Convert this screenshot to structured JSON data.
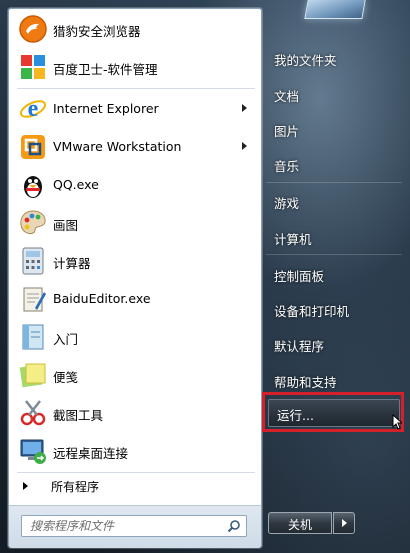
{
  "pinned_programs": [
    {
      "label": "猎豹安全浏览器",
      "icon": "cheetah-browser-icon"
    },
    {
      "label": "百度卫士-软件管理",
      "icon": "baidu-guard-software-icon"
    }
  ],
  "recent_programs": [
    {
      "label": "Internet Explorer",
      "icon": "internet-explorer-icon",
      "has_submenu": true
    },
    {
      "label": "VMware Workstation",
      "icon": "vmware-workstation-icon",
      "has_submenu": true
    },
    {
      "label": "QQ.exe",
      "icon": "qq-penguin-icon",
      "has_submenu": false
    },
    {
      "label": "画图",
      "icon": "paint-palette-icon",
      "has_submenu": false
    },
    {
      "label": "计算器",
      "icon": "calculator-icon",
      "has_submenu": false
    },
    {
      "label": "BaiduEditor.exe",
      "icon": "baidu-editor-icon",
      "has_submenu": false
    },
    {
      "label": "入门",
      "icon": "getting-started-icon",
      "has_submenu": false
    },
    {
      "label": "便笺",
      "icon": "sticky-notes-icon",
      "has_submenu": false
    },
    {
      "label": "截图工具",
      "icon": "snipping-tool-icon",
      "has_submenu": false
    },
    {
      "label": "远程桌面连接",
      "icon": "remote-desktop-icon",
      "has_submenu": false
    }
  ],
  "all_programs_label": "所有程序",
  "search": {
    "placeholder": "搜索程序和文件"
  },
  "right_items": [
    "我的文件夹",
    "文档",
    "图片",
    "音乐",
    "游戏",
    "计算机",
    "控制面板",
    "设备和打印机",
    "默认程序",
    "帮助和支持"
  ],
  "run_label": "运行...",
  "shutdown_label": "关机",
  "colors": {
    "highlight_border": "#d4202a",
    "left_pane_bg": "#ffffff",
    "right_text": "#ffffff"
  }
}
